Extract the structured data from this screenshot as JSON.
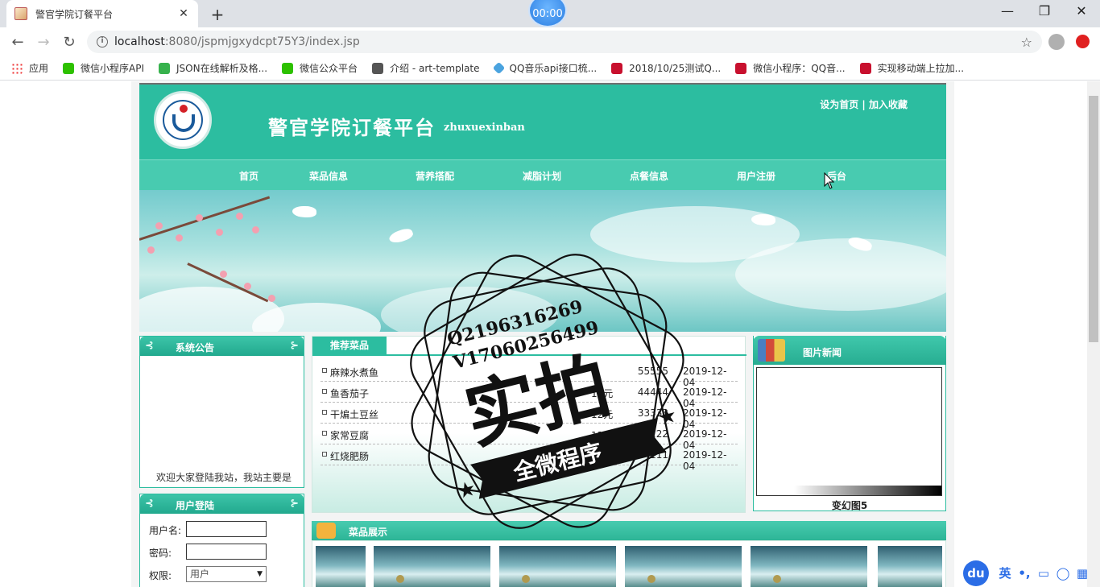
{
  "browser": {
    "tab_title": "警官学院订餐平台",
    "tab_close": "✕",
    "new_tab": "+",
    "timer": "00:00",
    "url_host": "localhost",
    "url_path": ":8080/jspmjgxydcpt75Y3/index.jsp",
    "bookmarks": [
      {
        "label": "应用",
        "icon": "apps-icon"
      },
      {
        "label": "微信小程序API",
        "icon": "wechat-icon"
      },
      {
        "label": "JSON在线解析及格...",
        "icon": "json-icon"
      },
      {
        "label": "微信公众平台",
        "icon": "wechat-icon"
      },
      {
        "label": "介绍 - art-template",
        "icon": "globe-icon"
      },
      {
        "label": "QQ音乐api接口梳...",
        "icon": "qq-music-icon"
      },
      {
        "label": "2018/10/25测试Q...",
        "icon": "csdn-icon"
      },
      {
        "label": "微信小程序：QQ音...",
        "icon": "csdn-icon"
      },
      {
        "label": "实现移动端上拉加...",
        "icon": "csdn-icon"
      }
    ]
  },
  "header": {
    "title": "警官学院订餐平台",
    "subtitle": "zhuxuexinban",
    "links": "设为首页 | 加入收藏"
  },
  "nav": [
    "首页",
    "菜品信息",
    "营养搭配",
    "减脂计划",
    "点餐信息",
    "用户注册",
    "后台"
  ],
  "notice": {
    "title": "系统公告",
    "text": "欢迎大家登陆我站，我站主要是"
  },
  "login": {
    "title": "用户登陆",
    "username_label": "用户名:",
    "password_label": "密码:",
    "role_label": "权限:",
    "role_value": "用户"
  },
  "recommend": {
    "title": "推荐菜品",
    "rows": [
      {
        "name": "麻辣水煮鱼",
        "price": "",
        "count": "55555",
        "date": "2019-12-04"
      },
      {
        "name": "鱼香茄子",
        "price": "13元",
        "count": "44444",
        "date": "2019-12-04"
      },
      {
        "name": "干煸土豆丝",
        "price": "12元",
        "count": "33333",
        "date": "2019-12-04"
      },
      {
        "name": "家常豆腐",
        "price": "11元",
        "count": "2222",
        "date": "2019-12-04"
      },
      {
        "name": "红烧肥肠",
        "price": "10元",
        "count": "111",
        "date": "2019-12-04"
      }
    ]
  },
  "news": {
    "title": "图片新闻",
    "caption": "变幻图5"
  },
  "dishes": {
    "title": "菜品展示"
  },
  "watermark": {
    "line1": "Q2196316269",
    "line2": "V17060256499",
    "main": "实拍",
    "ribbon": "全微程序"
  },
  "ime": {
    "logo": "du",
    "lang": "英",
    "punct": "•,"
  },
  "colors": {
    "brand": "#2cbda0",
    "nav": "#48cbb0"
  }
}
